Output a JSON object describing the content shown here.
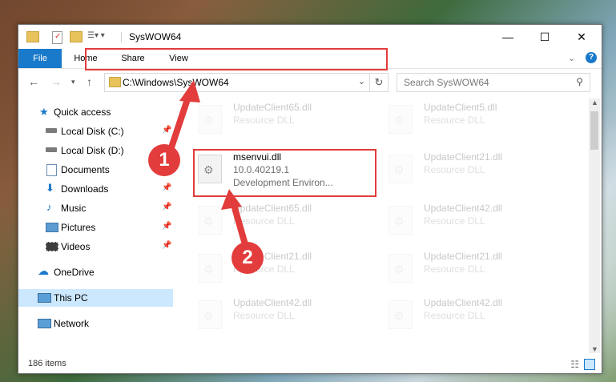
{
  "window": {
    "title": "SysWOW64"
  },
  "ribbon": {
    "tabs": [
      "File",
      "Home",
      "Share",
      "View"
    ]
  },
  "nav": {
    "address": "C:\\Windows\\SysWOW64",
    "search_placeholder": "Search SysWOW64"
  },
  "sidebar": {
    "items": [
      {
        "label": "Quick access"
      },
      {
        "label": "Local Disk (C:)"
      },
      {
        "label": "Local Disk (D:)"
      },
      {
        "label": "Documents"
      },
      {
        "label": "Downloads"
      },
      {
        "label": "Music"
      },
      {
        "label": "Pictures"
      },
      {
        "label": "Videos"
      },
      {
        "label": "OneDrive"
      },
      {
        "label": "This PC"
      },
      {
        "label": "Network"
      }
    ]
  },
  "files": {
    "left": [
      {
        "name": "UpdateClient65.dll",
        "type": "Resource DLL"
      },
      {
        "name": "msenvui.dll",
        "line2": "10.0.40219.1",
        "line3": "Development Environ..."
      },
      {
        "name": "UpdateClient65.dll",
        "type": "Resource DLL"
      },
      {
        "name": "UpdateClient21.dll",
        "type": "Resource DLL"
      },
      {
        "name": "UpdateClient42.dll",
        "type": "Resource DLL"
      }
    ],
    "right": [
      {
        "name": "UpdateClient5.dll",
        "type": "Resource DLL"
      },
      {
        "name": "UpdateClient21.dll",
        "type": "Resource DLL"
      },
      {
        "name": "UpdateClient42.dll",
        "type": "Resource DLL"
      },
      {
        "name": "UpdateClient21.dll",
        "type": "Resource DLL"
      },
      {
        "name": "UpdateClient42.dll",
        "type": "Resource DLL"
      }
    ]
  },
  "status": {
    "count": "186 items"
  },
  "annotations": {
    "step1": "1",
    "step2": "2"
  },
  "colors": {
    "accent": "#1979ca",
    "highlight": "#e23c3c",
    "selected": "#cce8ff"
  }
}
